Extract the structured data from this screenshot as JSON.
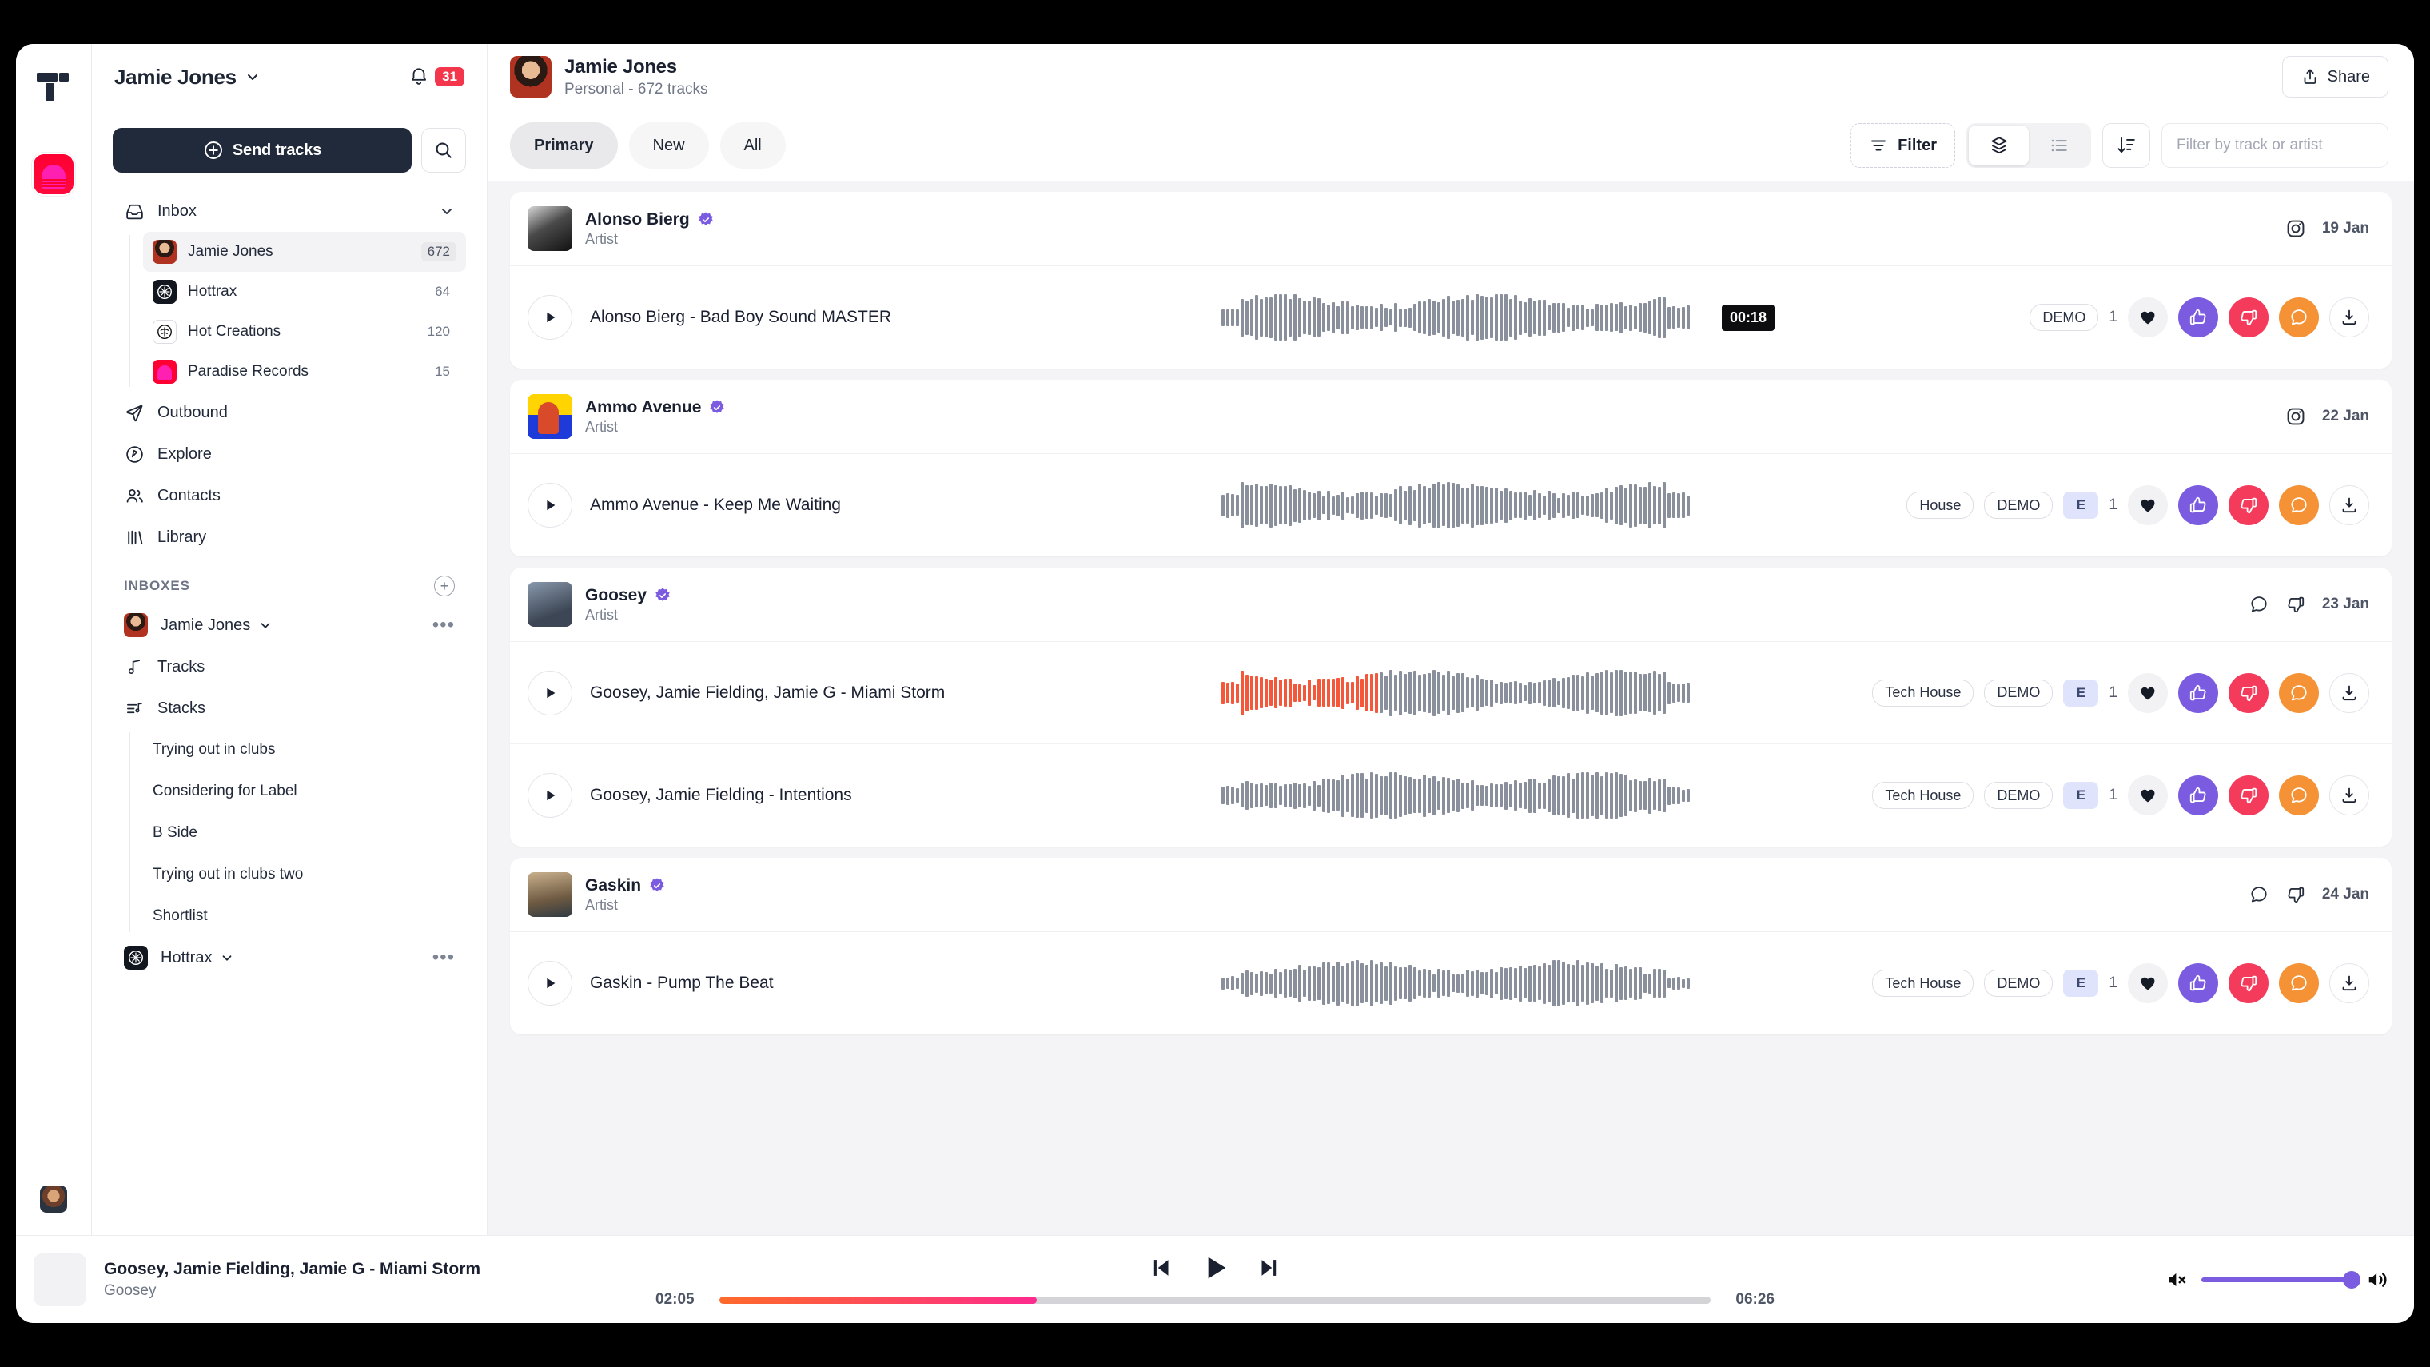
{
  "sidebar": {
    "user_name": "Jamie Jones",
    "notification_count": "31",
    "send_tracks_label": "Send tracks",
    "inbox_label": "Inbox",
    "inbox_items": [
      {
        "label": "Jamie Jones",
        "count": "672",
        "icon": "avatar-jamie"
      },
      {
        "label": "Hottrax",
        "count": "64",
        "icon": "hottrax-logo"
      },
      {
        "label": "Hot Creations",
        "count": "120",
        "icon": "hot-creations-logo"
      },
      {
        "label": "Paradise Records",
        "count": "15",
        "icon": "paradise-logo"
      }
    ],
    "nav_items": [
      {
        "label": "Outbound",
        "icon": "send-icon"
      },
      {
        "label": "Explore",
        "icon": "compass-icon"
      },
      {
        "label": "Contacts",
        "icon": "people-icon"
      },
      {
        "label": "Library",
        "icon": "library-icon"
      }
    ],
    "inboxes_section_title": "INBOXES",
    "inbox_account": "Jamie Jones",
    "account_nav": [
      {
        "label": "Tracks",
        "icon": "music-note-icon"
      },
      {
        "label": "Stacks",
        "icon": "stacks-icon"
      }
    ],
    "stacks": [
      "Trying out in clubs",
      "Considering for Label",
      "B Side",
      "Trying out in clubs two",
      "Shortlist"
    ],
    "second_account": "Hottrax"
  },
  "header": {
    "title": "Jamie Jones",
    "subtitle": "Personal - 672 tracks",
    "share_label": "Share"
  },
  "filterbar": {
    "chips": [
      {
        "label": "Primary",
        "selected": true
      },
      {
        "label": "New",
        "selected": false
      },
      {
        "label": "All",
        "selected": false
      }
    ],
    "filter_label": "Filter",
    "search_placeholder": "Filter by track or artist"
  },
  "groups": [
    {
      "artist": "Alonso Bierg",
      "role": "Artist",
      "verified": true,
      "date": "19 Jan",
      "meta_icons": [
        "instagram-icon"
      ],
      "cover": "ac1",
      "tracks": [
        {
          "title": "Alonso Bierg - Bad Boy Sound MASTER",
          "tags": [
            "DEMO"
          ],
          "explicit": false,
          "like_count": "1",
          "time_badge": "00:18",
          "playing": false
        }
      ]
    },
    {
      "artist": "Ammo Avenue",
      "role": "Artist",
      "verified": true,
      "date": "22 Jan",
      "meta_icons": [
        "instagram-icon"
      ],
      "cover": "ac2",
      "tracks": [
        {
          "title": "Ammo Avenue - Keep Me Waiting",
          "tags": [
            "House",
            "DEMO"
          ],
          "explicit": true,
          "like_count": "1",
          "time_badge": "",
          "playing": false
        }
      ]
    },
    {
      "artist": "Goosey",
      "role": "Artist",
      "verified": true,
      "date": "23 Jan",
      "meta_icons": [
        "comment-icon",
        "thumbs-down-icon"
      ],
      "cover": "ac3",
      "tracks": [
        {
          "title": "Goosey, Jamie Fielding, Jamie G - Miami Storm",
          "tags": [
            "Tech House",
            "DEMO"
          ],
          "explicit": true,
          "like_count": "1",
          "time_badge": "",
          "playing": true
        },
        {
          "title": "Goosey, Jamie Fielding - Intentions",
          "tags": [
            "Tech House",
            "DEMO"
          ],
          "explicit": true,
          "like_count": "1",
          "time_badge": "",
          "playing": false
        }
      ]
    },
    {
      "artist": "Gaskin",
      "role": "Artist",
      "verified": true,
      "date": "24 Jan",
      "meta_icons": [
        "comment-icon",
        "thumbs-down-icon"
      ],
      "cover": "ac4",
      "tracks": [
        {
          "title": "Gaskin - Pump The Beat",
          "tags": [
            "Tech House",
            "DEMO"
          ],
          "explicit": true,
          "like_count": "1",
          "time_badge": "",
          "playing": false
        }
      ]
    }
  ],
  "player": {
    "track_title": "Goosey, Jamie Fielding, Jamie G - Miami Storm",
    "artist": "Goosey",
    "current_time": "02:05",
    "total_time": "06:26",
    "progress_percent": 32,
    "volume_percent": 100
  },
  "colors": {
    "accent_purple": "#7b5ce0",
    "accent_red": "#f53b5c",
    "accent_orange": "#f59236",
    "badge_red": "#f4364c",
    "dark": "#212a3a",
    "waveform_played": "#f4573a",
    "waveform": "#8a8f9c"
  }
}
